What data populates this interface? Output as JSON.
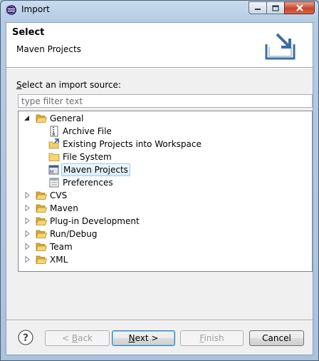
{
  "window": {
    "title": "Import",
    "minimize_icon": "minimize-icon",
    "maximize_icon": "maximize-icon",
    "close_icon": "close-icon"
  },
  "header": {
    "title": "Select",
    "subtitle": "Maven Projects",
    "icon": "import-wizard-icon"
  },
  "source": {
    "label_mnemonic": "S",
    "label_rest": "elect an import source:",
    "filter_placeholder": "type filter text",
    "filter_value": ""
  },
  "tree": {
    "group": {
      "label": "General",
      "expanded": true,
      "icon": "folder-open-icon"
    },
    "children": [
      {
        "label": "Archive File",
        "icon": "archive-file-icon"
      },
      {
        "label": "Existing Projects into Workspace",
        "icon": "existing-projects-icon"
      },
      {
        "label": "File System",
        "icon": "folder-icon"
      },
      {
        "label": "Maven Projects",
        "icon": "maven-projects-icon",
        "selected": true
      },
      {
        "label": "Preferences",
        "icon": "preferences-icon"
      }
    ],
    "collapsed": [
      {
        "label": "CVS"
      },
      {
        "label": "Maven"
      },
      {
        "label": "Plug-in Development"
      },
      {
        "label": "Run/Debug"
      },
      {
        "label": "Team"
      },
      {
        "label": "XML"
      }
    ]
  },
  "buttons": {
    "help_icon": "help-icon",
    "back": {
      "prefix": "< ",
      "mnemonic": "B",
      "rest": "ack",
      "enabled": false
    },
    "next": {
      "mnemonic": "N",
      "rest": "ext >",
      "enabled": true
    },
    "finish": {
      "mnemonic": "F",
      "rest": "inish",
      "enabled": false
    },
    "cancel": {
      "label": "Cancel",
      "enabled": true
    }
  }
}
